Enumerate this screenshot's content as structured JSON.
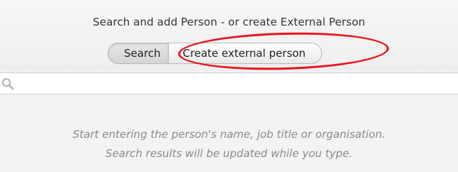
{
  "dialog": {
    "title": "Search and add Person - or create External Person"
  },
  "mode_toggle": {
    "search_label": "Search",
    "create_label": "Create external person",
    "selected": "Search"
  },
  "search": {
    "value": "",
    "placeholder": ""
  },
  "hint": {
    "line1": "Start entering the person's name, job title or organisation.",
    "line2": "Search results will be updated while you type."
  },
  "annotation": {
    "highlight_color": "#e8141d",
    "target": "Create external person"
  },
  "colors": {
    "panel_background": "#f3f3f3",
    "hint_text": "#8a8a8a",
    "highlight": "#e8141d"
  }
}
